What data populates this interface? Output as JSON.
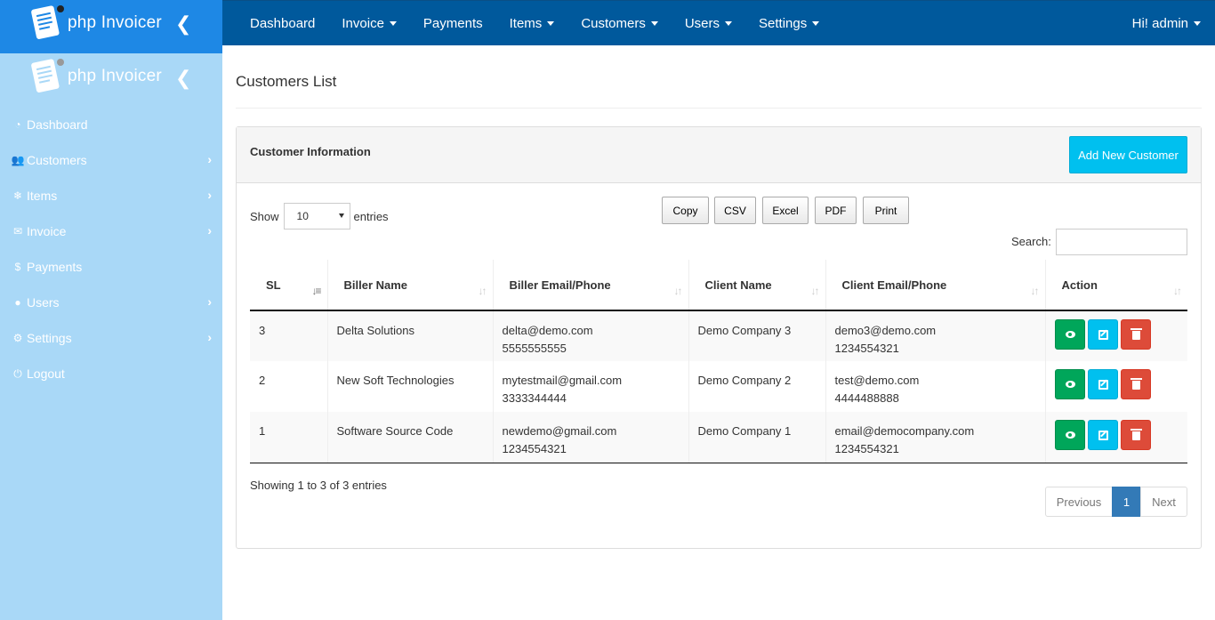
{
  "brand": {
    "name": "php Invoicer"
  },
  "sidebar": {
    "items": [
      {
        "label": "Dashboard",
        "icon": "dashboard-icon",
        "has_children": false
      },
      {
        "label": "Customers",
        "icon": "users-icon",
        "has_children": true
      },
      {
        "label": "Items",
        "icon": "snowflake-icon",
        "has_children": true
      },
      {
        "label": "Invoice",
        "icon": "envelope-icon",
        "has_children": true
      },
      {
        "label": "Payments",
        "icon": "dollar-icon",
        "has_children": false
      },
      {
        "label": "Users",
        "icon": "user-icon",
        "has_children": true
      },
      {
        "label": "Settings",
        "icon": "cogs-icon",
        "has_children": true
      },
      {
        "label": "Logout",
        "icon": "power-icon",
        "has_children": false
      }
    ]
  },
  "topnav": {
    "items": [
      {
        "label": "Dashboard",
        "dropdown": false
      },
      {
        "label": "Invoice",
        "dropdown": true
      },
      {
        "label": "Payments",
        "dropdown": false
      },
      {
        "label": "Items",
        "dropdown": true
      },
      {
        "label": "Customers",
        "dropdown": true
      },
      {
        "label": "Users",
        "dropdown": true
      },
      {
        "label": "Settings",
        "dropdown": true
      }
    ],
    "user": "Hi! admin"
  },
  "page": {
    "title": "Customers List"
  },
  "panel": {
    "title": "Customer Information",
    "add_button": "Add New Customer"
  },
  "table_controls": {
    "show_label": "Show",
    "entries_value": "10",
    "entries_label": "entries",
    "export_buttons": [
      "Copy",
      "CSV",
      "Excel",
      "PDF",
      "Print"
    ],
    "search_label": "Search:",
    "search_value": ""
  },
  "table": {
    "columns": [
      "SL",
      "Biller Name",
      "Biller Email/Phone",
      "Client Name",
      "Client Email/Phone",
      "Action"
    ],
    "rows": [
      {
        "sl": "3",
        "biller_name": "Delta Solutions",
        "biller_email": "delta@demo.com",
        "biller_phone": "5555555555",
        "client_name": "Demo Company 3",
        "client_email": "demo3@demo.com",
        "client_phone": "1234554321"
      },
      {
        "sl": "2",
        "biller_name": "New Soft Technologies",
        "biller_email": "mytestmail@gmail.com",
        "biller_phone": "3333344444",
        "client_name": "Demo Company 2",
        "client_email": "test@demo.com",
        "client_phone": "4444488888"
      },
      {
        "sl": "1",
        "biller_name": "Software Source Code",
        "biller_email": "newdemo@gmail.com",
        "biller_phone": "1234554321",
        "client_name": "Demo Company 1",
        "client_email": "email@democompany.com",
        "client_phone": "1234554321"
      }
    ]
  },
  "footer": {
    "info": "Showing 1 to 3 of 3 entries",
    "pager": {
      "previous": "Previous",
      "current": "1",
      "next": "Next"
    }
  },
  "colors": {
    "sidebar_bg": "#a9d8f7",
    "brand_bg": "#1e88e5",
    "topbar_bg": "#00599c",
    "view_button": "#00a65a",
    "edit_button": "#00c0ef",
    "delete_button": "#dd4b39",
    "pager_active": "#337ab7"
  }
}
